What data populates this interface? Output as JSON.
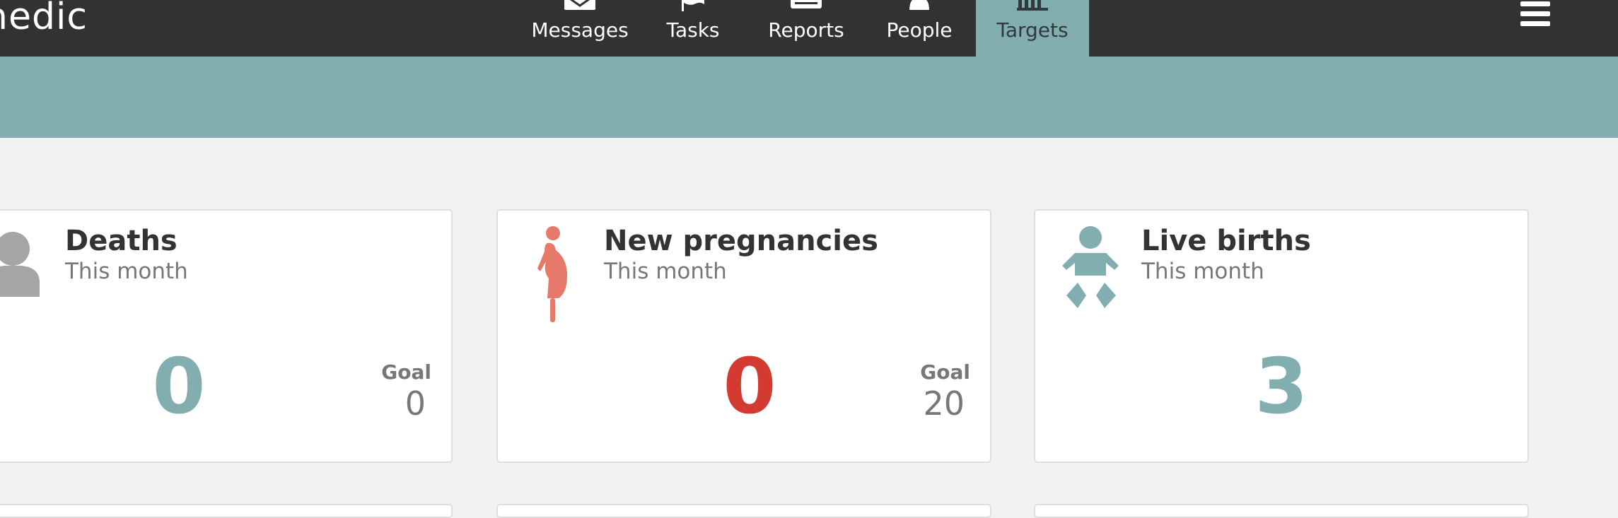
{
  "app": {
    "brand": "nedic"
  },
  "nav": {
    "tabs": [
      {
        "label": "Messages",
        "icon": "envelope-icon"
      },
      {
        "label": "Tasks",
        "icon": "flag-icon"
      },
      {
        "label": "Reports",
        "icon": "list-icon"
      },
      {
        "label": "People",
        "icon": "person-icon"
      },
      {
        "label": "Targets",
        "icon": "bar-chart-icon",
        "active": true
      }
    ],
    "menu_icon": "hamburger-menu-icon"
  },
  "colors": {
    "topbar": "#323232",
    "accent": "#83aeb0",
    "teal_value": "#83aeb0",
    "red_value": "#d23a32",
    "pregnancy_icon": "#e6796a",
    "death_icon": "#a5a5a7"
  },
  "targets": [
    {
      "title": "Deaths",
      "period": "This month",
      "value": "0",
      "goal_label": "Goal",
      "goal": "0",
      "icon": "person-silhouette-icon"
    },
    {
      "title": "New pregnancies",
      "period": "This month",
      "value": "0",
      "goal_label": "Goal",
      "goal": "20",
      "icon": "pregnant-woman-icon"
    },
    {
      "title": "Live births",
      "period": "This month",
      "value": "3",
      "icon": "baby-icon"
    }
  ]
}
